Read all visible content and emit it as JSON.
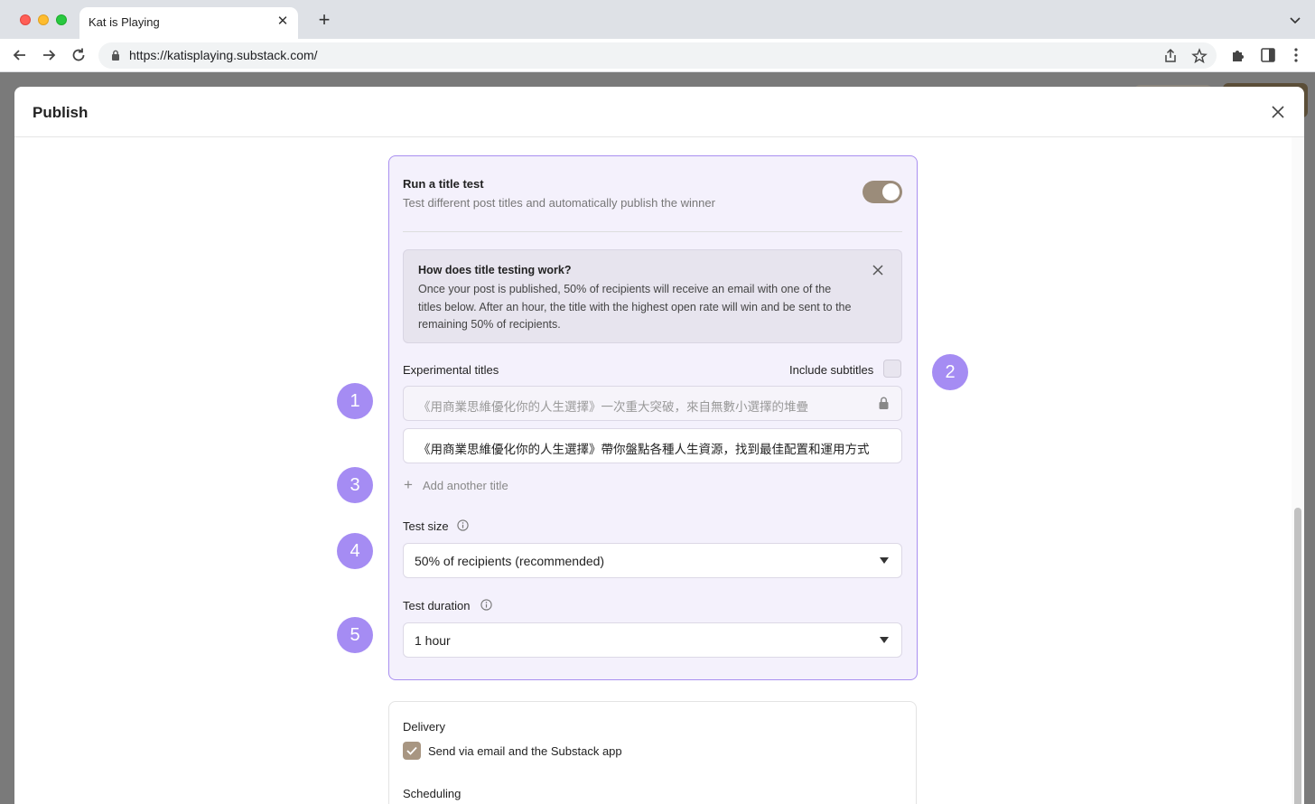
{
  "browser": {
    "tab_title": "Kat is Playing",
    "tab_close": "✕",
    "new_tab": "+",
    "url": "https://katisplaying.substack.com/"
  },
  "modal": {
    "title": "Publish"
  },
  "title_test": {
    "label": "Run a title test",
    "description": "Test different post titles and automatically publish the winner",
    "enabled": true,
    "info_title": "How does title testing work?",
    "info_body": "Once your post is published, 50% of recipients will receive an email with one of the titles below. After an hour, the title with the highest open rate will win and be sent to the remaining 50% of recipients.",
    "experimental_titles_label": "Experimental titles",
    "include_subtitles_label": "Include subtitles",
    "titles": [
      "《用商業思維優化你的人生選擇》一次重大突破，來自無數小選擇的堆疊",
      "《用商業思維優化你的人生選擇》帶你盤點各種人生資源，找到最佳配置和運用方式"
    ],
    "add_title_plus": "+",
    "add_title_label": "Add another title",
    "test_size_label": "Test size",
    "test_size_value": "50% of recipients (recommended)",
    "test_duration_label": "Test duration",
    "test_duration_value": "1 hour"
  },
  "badges": [
    "1",
    "2",
    "3",
    "4",
    "5"
  ],
  "delivery": {
    "label": "Delivery",
    "option_label": "Send via email and the Substack app",
    "checked": true,
    "scheduling_label": "Scheduling"
  },
  "colors": {
    "accent": "#a58cf3",
    "card_bg": "#f4f1fc",
    "toggle": "#9b8c7a"
  }
}
